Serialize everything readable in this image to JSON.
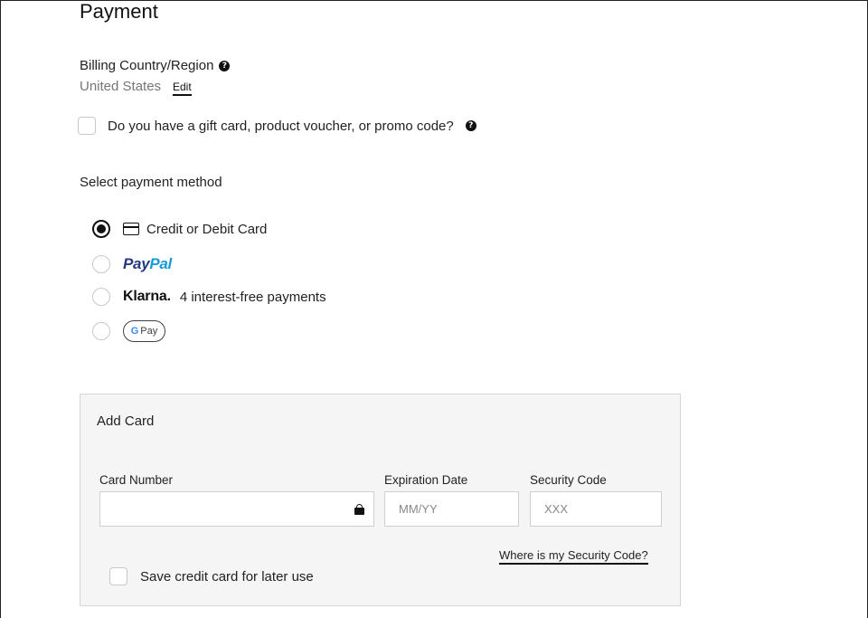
{
  "page": {
    "title": "Payment"
  },
  "billing": {
    "label": "Billing Country/Region",
    "help_icon": "question-circle-icon",
    "value": "United States",
    "edit_label": "Edit"
  },
  "gift": {
    "label": "Do you have a gift card, product voucher, or promo code?",
    "checked": false,
    "help_icon": "question-circle-icon"
  },
  "payment_methods": {
    "label": "Select payment method",
    "options": [
      {
        "id": "card",
        "label": "Credit or Debit Card",
        "icon": "credit-card-icon",
        "selected": true
      },
      {
        "id": "paypal",
        "logo_part1": "Pay",
        "logo_part2": "Pal",
        "selected": false
      },
      {
        "id": "klarna",
        "logo": "Klarna.",
        "label": "4 interest-free payments",
        "selected": false
      },
      {
        "id": "gpay",
        "logo_g": "G",
        "logo_text": "Pay",
        "selected": false
      }
    ]
  },
  "add_card": {
    "title": "Add Card",
    "card_number": {
      "label": "Card Number",
      "value": "",
      "placeholder": "",
      "icon": "lock-icon"
    },
    "expiration": {
      "label": "Expiration Date",
      "value": "",
      "placeholder": "MM/YY"
    },
    "security": {
      "label": "Security Code",
      "value": "",
      "placeholder": "XXX"
    },
    "security_help_link": "Where is my Security Code?",
    "save_card": {
      "label": "Save credit card for later use",
      "checked": false
    }
  },
  "colors": {
    "paypal_dark": "#253b80",
    "paypal_light": "#179bd7",
    "panel_bg": "#f5f5f5",
    "muted_text": "#767676"
  }
}
